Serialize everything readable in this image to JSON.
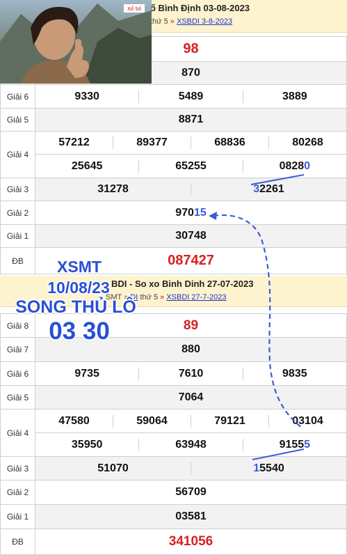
{
  "top": {
    "title": "ố Bình Định 03-08-2023",
    "sub_day": "thứ 5",
    "sub_link": "XSBDI 3-8-2023",
    "photo_logo": "Xổ Số",
    "rows": {
      "g8": "98",
      "g7": "870",
      "g6": [
        "9330",
        "5489",
        "3889"
      ],
      "g5": "8871",
      "g4a": [
        "57212",
        "89377",
        "68836",
        "80268"
      ],
      "g4b_plain": [
        "25645",
        "65255",
        "0828"
      ],
      "g4b_hl": "0",
      "g3_plain1": "31278",
      "g3_hl": "3",
      "g3_rest": "2261",
      "g2_plain": "970",
      "g2_hl": "15",
      "g1": "30748",
      "db": "087427"
    },
    "labels": {
      "g6": "Giải 6",
      "g5": "Giải 5",
      "g4": "Giải 4",
      "g3": "Giải 3",
      "g2": "Giải 2",
      "g1": "Giải 1",
      "db": "ĐB"
    }
  },
  "bottom": {
    "title": "BDI - So xo Binh Dinh 27-07-2023",
    "sub_pre": "SMT",
    "sub_link1": "DI",
    "sub_day": "thứ 5",
    "sub_link2": "XSBDI 27-7-2023",
    "rows": {
      "g8": "89",
      "g7": "880",
      "g6": [
        "9735",
        "7610",
        "9835"
      ],
      "g5": "7064",
      "g4a": [
        "47580",
        "59064",
        "79121",
        "03104"
      ],
      "g4b_plain": [
        "35950",
        "63948",
        "9155"
      ],
      "g4b_hl": "5",
      "g3_plain1": "51070",
      "g3_hl": "1",
      "g3_rest": "5540",
      "g2": "56709",
      "g1": "03581",
      "db": "341056"
    },
    "labels": {
      "g8": "Giải 8",
      "g7": "Giải 7",
      "g6": "Giải 6",
      "g5": "Giải 5",
      "g4": "Giải 4",
      "g3": "Giải 3",
      "g2": "Giải 2",
      "g1": "Giải 1",
      "db": "ĐB"
    }
  },
  "overlay": {
    "line1": "XSMT",
    "line2": "10/08/23",
    "line3": "SONG THỦ LÔ",
    "line4": "03 30"
  },
  "colors": {
    "red": "#d32222",
    "blue_highlight": "#3b5bd9",
    "header_bg": "#fdf3cf",
    "dashed_arrow": "#3b5bd9"
  }
}
